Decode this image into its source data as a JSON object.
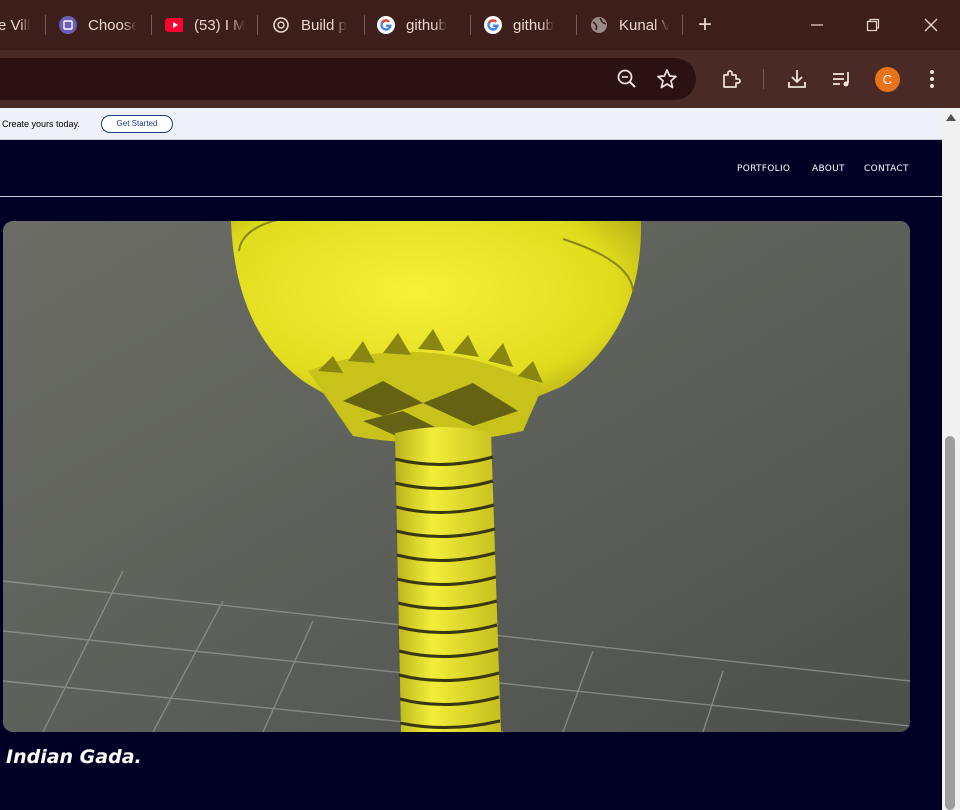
{
  "browser": {
    "tabs": [
      {
        "title": "e Vill",
        "icon": "page-favicon"
      },
      {
        "title": "Choose",
        "icon": "book-favicon"
      },
      {
        "title": "(53) I M",
        "icon": "youtube-favicon"
      },
      {
        "title": "Build p",
        "icon": "openai-favicon"
      },
      {
        "title": "github",
        "icon": "google-favicon"
      },
      {
        "title": "github",
        "icon": "google-favicon"
      },
      {
        "title": "Kunal V",
        "icon": "globe-favicon"
      }
    ],
    "new_tab": "+",
    "profile_initial": "C"
  },
  "banner": {
    "text": "Create yours today.",
    "button": "Get Started"
  },
  "nav": {
    "links": [
      "PORTFOLIO",
      "ABOUT",
      "CONTACT"
    ]
  },
  "content": {
    "caption": "Indian Gada."
  },
  "colors": {
    "page_bg": "#000125",
    "tabstrip": "#3c1f1b",
    "toolbar": "#4a2a26",
    "avatar": "#e8731a"
  }
}
